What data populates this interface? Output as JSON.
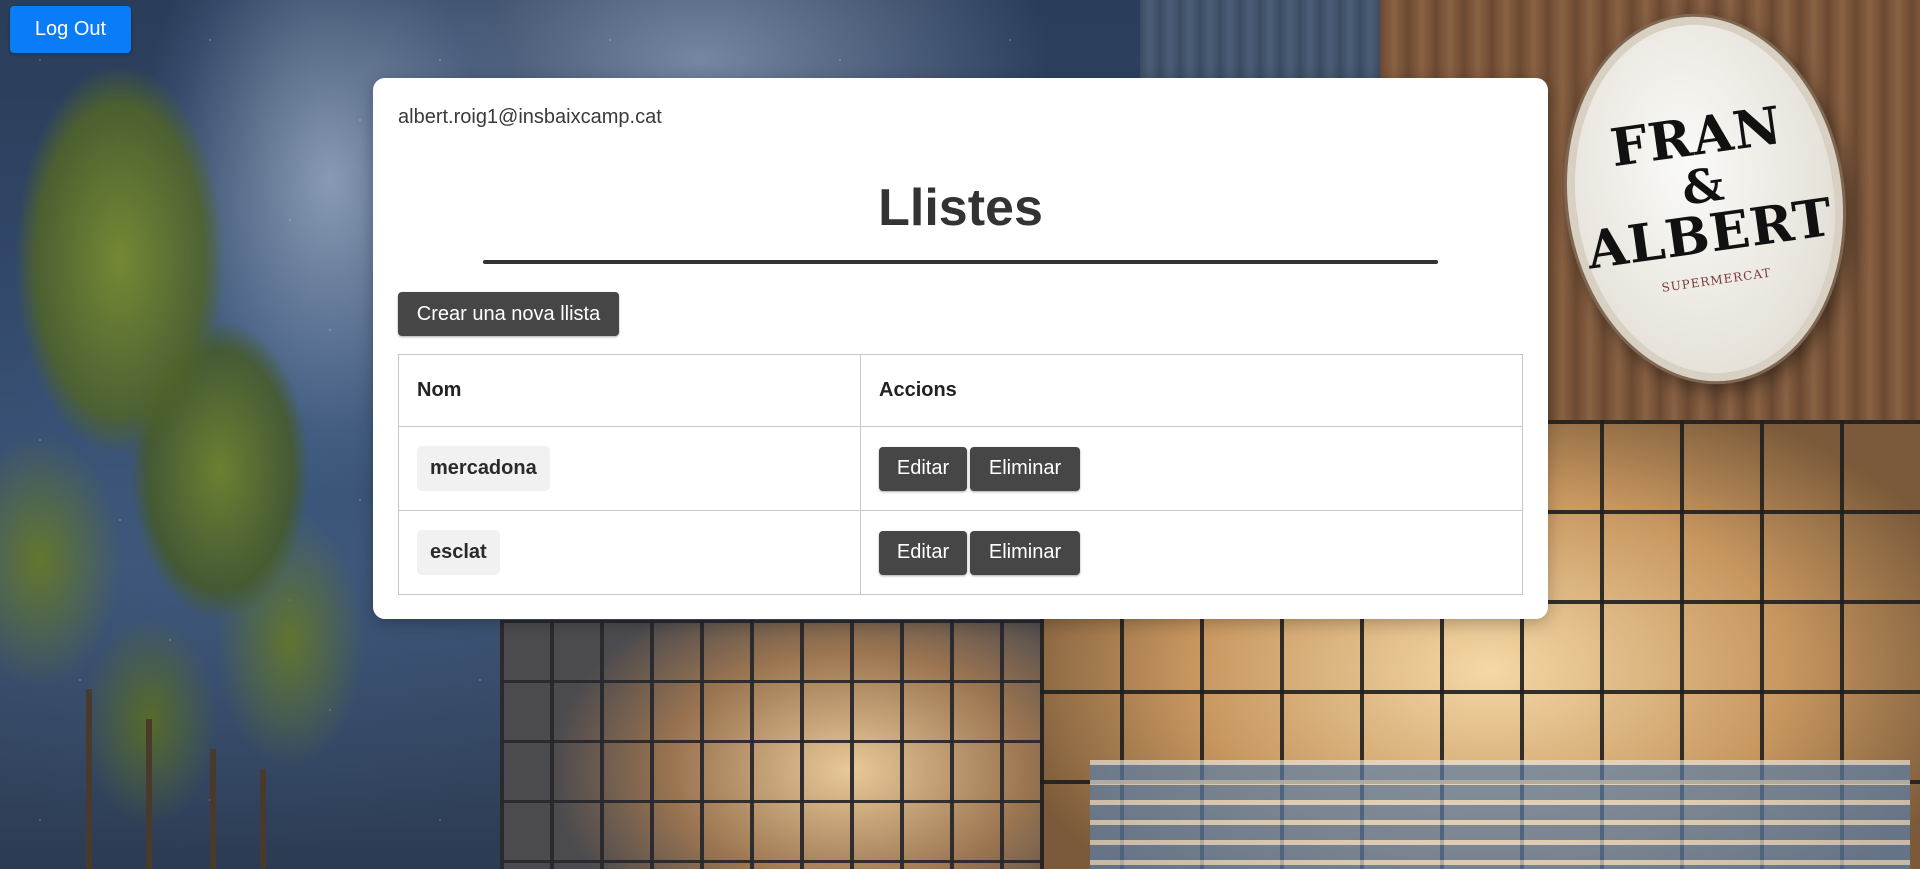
{
  "header": {
    "logout_label": "Log Out"
  },
  "card": {
    "user_email": "albert.roig1@insbaixcamp.cat",
    "title": "Llistes",
    "create_button_label": "Crear una nova llista"
  },
  "table": {
    "columns": [
      "Nom",
      "Accions"
    ],
    "rows": [
      {
        "name": "mercadona",
        "edit_label": "Editar",
        "delete_label": "Eliminar"
      },
      {
        "name": "esclat",
        "edit_label": "Editar",
        "delete_label": "Eliminar"
      }
    ]
  },
  "background": {
    "sign_lines": [
      "FRAN",
      "&",
      "ALBERT"
    ],
    "sign_subtitle": "SUPERMERCAT"
  },
  "colors": {
    "logout_button": "#0a7cf7",
    "dark_button": "#464646",
    "card_background": "#ffffff"
  }
}
